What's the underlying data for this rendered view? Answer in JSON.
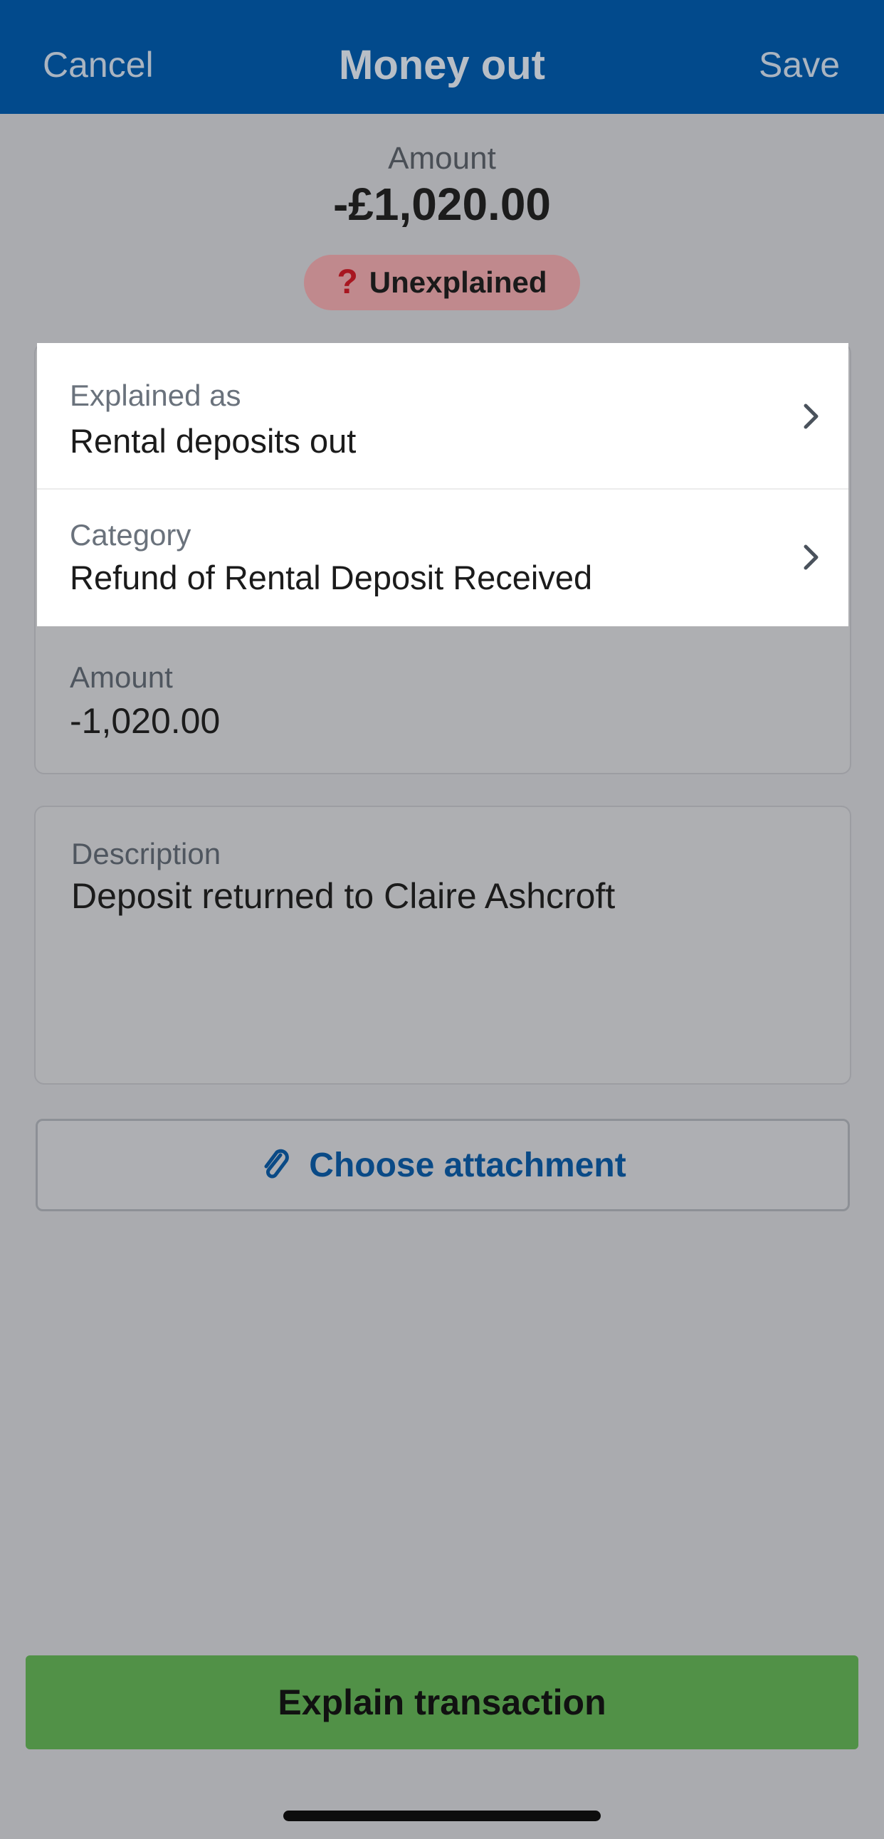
{
  "header": {
    "cancel_label": "Cancel",
    "title": "Money out",
    "save_label": "Save",
    "background_color": "#024a8c"
  },
  "summary": {
    "amount_label": "Amount",
    "amount_value": "-£1,020.00",
    "status": {
      "icon": "question-mark-icon",
      "label": "Unexplained",
      "color": "#a81620"
    }
  },
  "form": {
    "explained_as": {
      "label": "Explained as",
      "value": "Rental deposits out",
      "icon": "chevron-right-icon"
    },
    "category": {
      "label": "Category",
      "value": "Refund of Rental Deposit Received",
      "icon": "chevron-right-icon"
    },
    "amount": {
      "label": "Amount",
      "value": "-1,020.00"
    }
  },
  "description": {
    "label": "Description",
    "value": "Deposit returned to Claire Ashcroft"
  },
  "attachment": {
    "icon": "paperclip-icon",
    "label": "Choose attachment"
  },
  "footer": {
    "explain_label": "Explain transaction",
    "button_color": "#519147"
  }
}
